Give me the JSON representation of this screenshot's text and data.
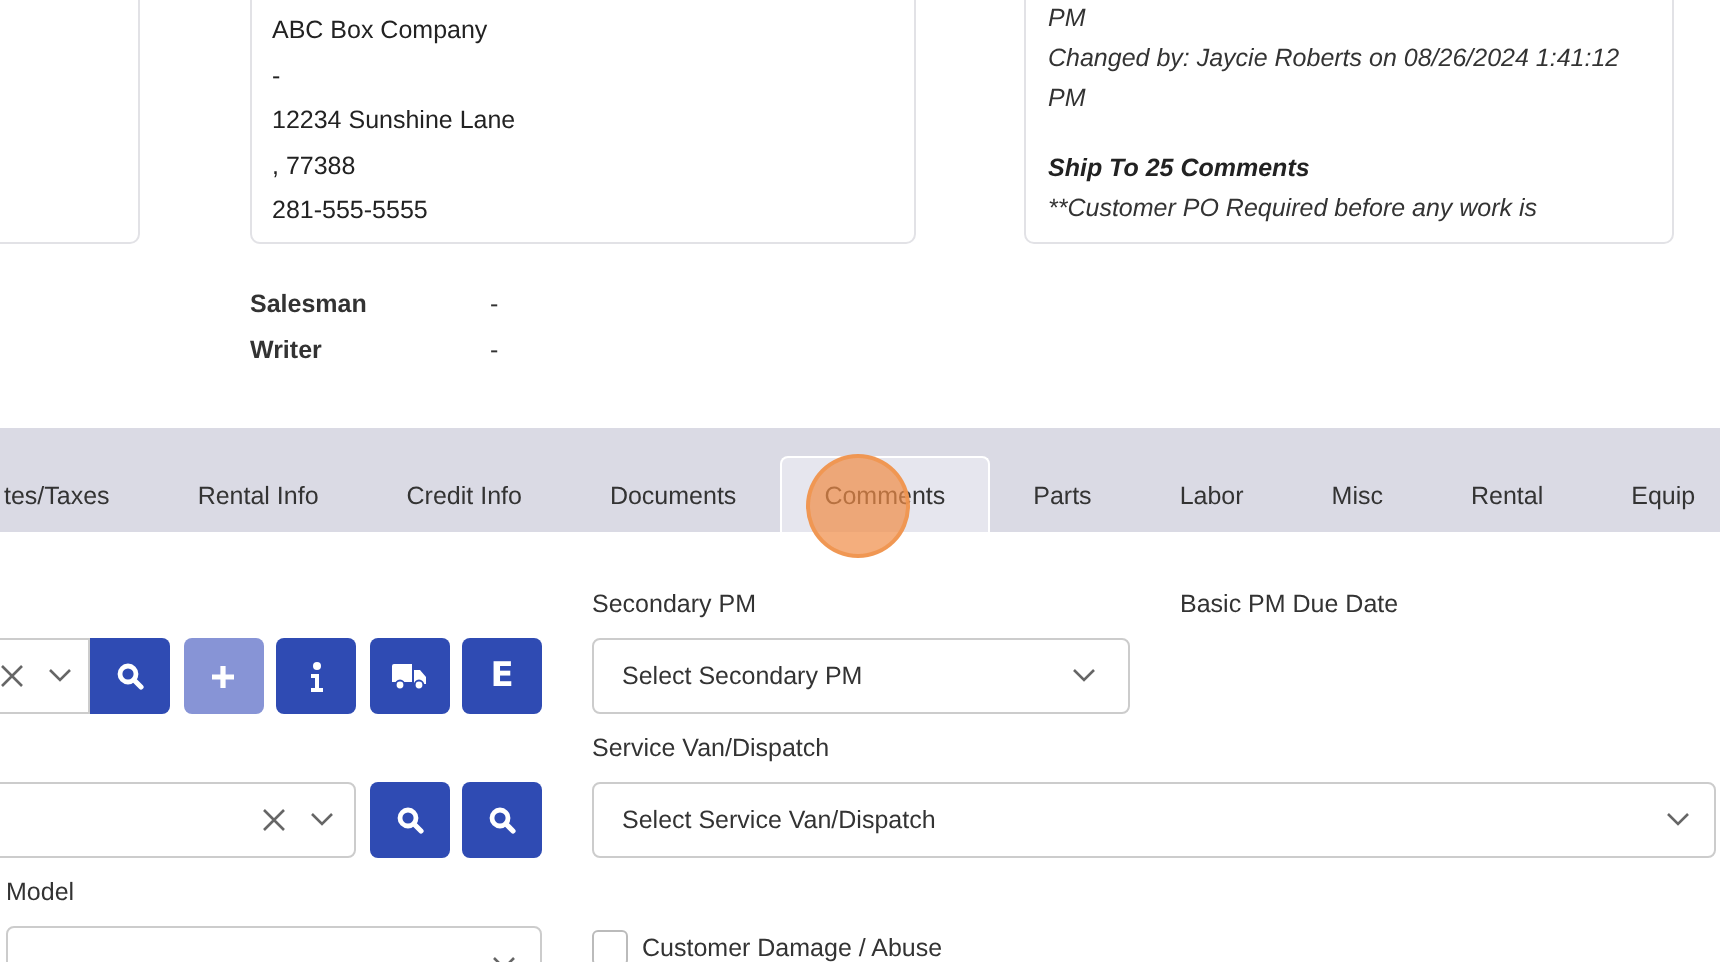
{
  "address_card": {
    "lines": [
      "ABC Box Company",
      "-",
      "12234 Sunshine Lane",
      ", 77388",
      "281-555-5555"
    ]
  },
  "comments_card": {
    "lines": [
      "PM",
      "Changed by: Jaycie Roberts on 08/26/2024 1:41:12 PM"
    ],
    "heading": "Ship To 25 Comments",
    "text": "**Customer PO Required before any work is"
  },
  "info": [
    {
      "label": "Salesman",
      "value": "-"
    },
    {
      "label": "Writer",
      "value": "-"
    }
  ],
  "tabs": [
    {
      "label": "tes/Taxes",
      "selected": false
    },
    {
      "label": "Rental Info",
      "selected": false
    },
    {
      "label": "Credit Info",
      "selected": false
    },
    {
      "label": "Documents",
      "selected": false
    },
    {
      "label": "Comments",
      "selected": true
    },
    {
      "label": "Parts",
      "selected": false
    },
    {
      "label": "Labor",
      "selected": false
    },
    {
      "label": "Misc",
      "selected": false
    },
    {
      "label": "Rental",
      "selected": false
    },
    {
      "label": "Equip",
      "selected": false
    }
  ],
  "row1_buttons": [
    {
      "kind": "search",
      "disabled": false
    },
    {
      "kind": "add",
      "disabled": true
    },
    {
      "kind": "info",
      "disabled": false
    },
    {
      "kind": "truck",
      "disabled": false
    },
    {
      "kind": "letter",
      "label": "E",
      "disabled": false
    }
  ],
  "row2_buttons": [
    {
      "kind": "search",
      "disabled": false
    },
    {
      "kind": "search",
      "disabled": false
    }
  ],
  "secondary_pm": {
    "label": "Secondary PM",
    "placeholder": "Select Secondary PM"
  },
  "basic_pm_due_date": {
    "label": "Basic PM Due Date"
  },
  "service_van": {
    "label": "Service Van/Dispatch",
    "placeholder": "Select Service Van/Dispatch"
  },
  "model": {
    "label": "Model"
  },
  "customer_damage": {
    "label": "Customer Damage / Abuse",
    "checked": false
  }
}
